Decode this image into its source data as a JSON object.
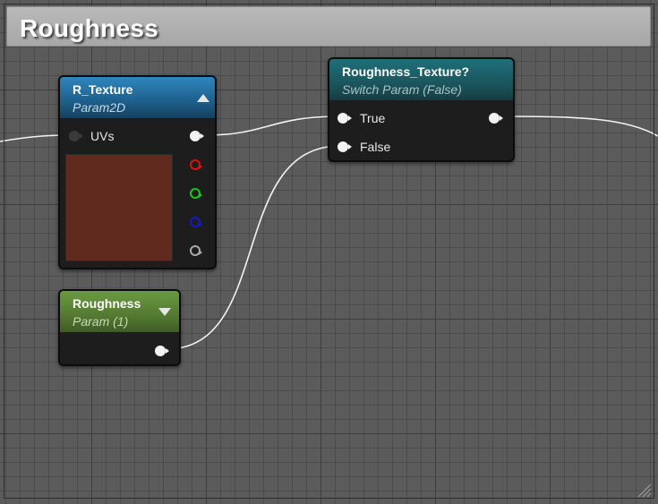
{
  "comment": {
    "title": "Roughness"
  },
  "nodes": {
    "texture": {
      "title": "R_Texture",
      "subtitle": "Param2D",
      "input_label": "UVs",
      "preview_color": "#602a1e",
      "header_color": "#1f6e9c"
    },
    "switch": {
      "title": "Roughness_Texture?",
      "subtitle": "Switch Param (False)",
      "inputs": [
        "True",
        "False"
      ],
      "header_color": "#1e5a62"
    },
    "roughness": {
      "title": "Roughness",
      "subtitle": "Param (1)",
      "header_color": "#5c8a36"
    }
  },
  "colors": {
    "wire": "#f2f2f2",
    "pin_red": "#e01010",
    "pin_green": "#18c818",
    "pin_blue": "#1818c8",
    "pin_grey": "#aaaaaa"
  }
}
